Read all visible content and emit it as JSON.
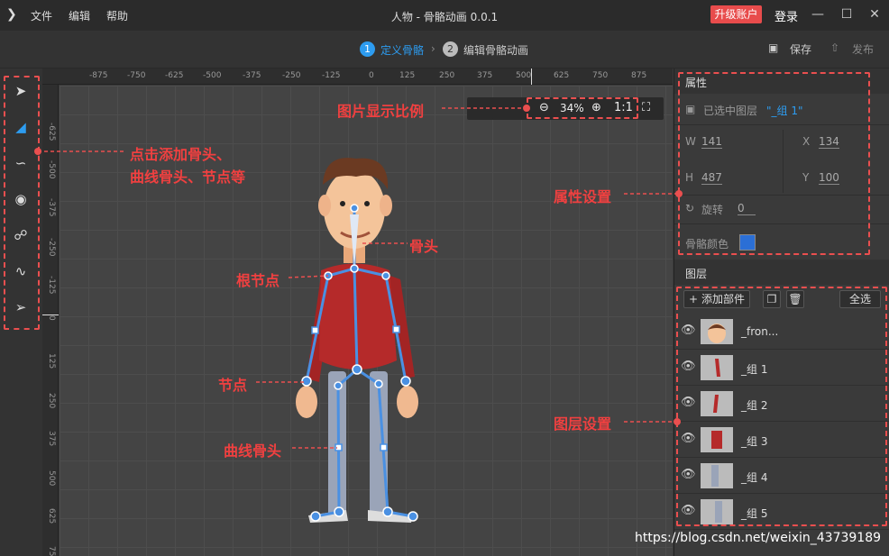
{
  "titlebar": {
    "logo_icon": "arrow-logo-icon",
    "menu": [
      "文件",
      "编辑",
      "帮助"
    ],
    "title": "人物 - 骨骼动画 0.0.1",
    "upgrade": "升级账户",
    "login": "登录",
    "window_buttons": {
      "minimize": "—",
      "maximize": "☐",
      "close": "✕"
    }
  },
  "steps": {
    "step1": {
      "num": "1",
      "label": "定义骨骼"
    },
    "step2": {
      "num": "2",
      "label": "编辑骨骼动画"
    },
    "save": "保存",
    "publish": "发布"
  },
  "rulers": {
    "h": [
      "-875",
      "-750",
      "-625",
      "-500",
      "-375",
      "-250",
      "-125",
      "0",
      "125",
      "250",
      "375",
      "500",
      "625",
      "750",
      "875"
    ],
    "v": [
      "-625",
      "-500",
      "-375",
      "-250",
      "-125",
      "0",
      "125",
      "250",
      "375",
      "500",
      "625",
      "75"
    ]
  },
  "zoom": {
    "value": "34%",
    "one_to_one": "1:1"
  },
  "properties": {
    "title": "属性",
    "selected_layer_label": "已选中图层",
    "selected_layer_value": "\"_组 1\"",
    "w_label": "W",
    "w": "141",
    "x_label": "X",
    "x": "134",
    "h_label": "H",
    "h": "487",
    "y_label": "Y",
    "y": "100",
    "rotate_label": "旋转",
    "rotate": "0",
    "bone_color_label": "骨骼颜色",
    "bone_color": "#2b6fd6"
  },
  "layers": {
    "title": "图层",
    "add_part": "添加部件",
    "select_all": "全选",
    "items": [
      {
        "name": "_fron..."
      },
      {
        "name": "_组 1"
      },
      {
        "name": "_组 2"
      },
      {
        "name": "_组 3"
      },
      {
        "name": "_组 4"
      },
      {
        "name": "_组 5"
      }
    ]
  },
  "annotations": {
    "tools_1": "点击添加骨头、",
    "tools_2": "曲线骨头、节点等",
    "zoom": "图片显示比例",
    "bone": "骨头",
    "root_node": "根节点",
    "node": "节点",
    "curve_bone": "曲线骨头",
    "property_settings": "属性设置",
    "layer_settings": "图层设置"
  },
  "colors": {
    "accent": "#2d9cf0",
    "annotation": "#ea4f4f",
    "bone": "#4a90e2",
    "shirt": "#b52a2a"
  },
  "watermark": "https://blog.csdn.net/weixin_43739189"
}
